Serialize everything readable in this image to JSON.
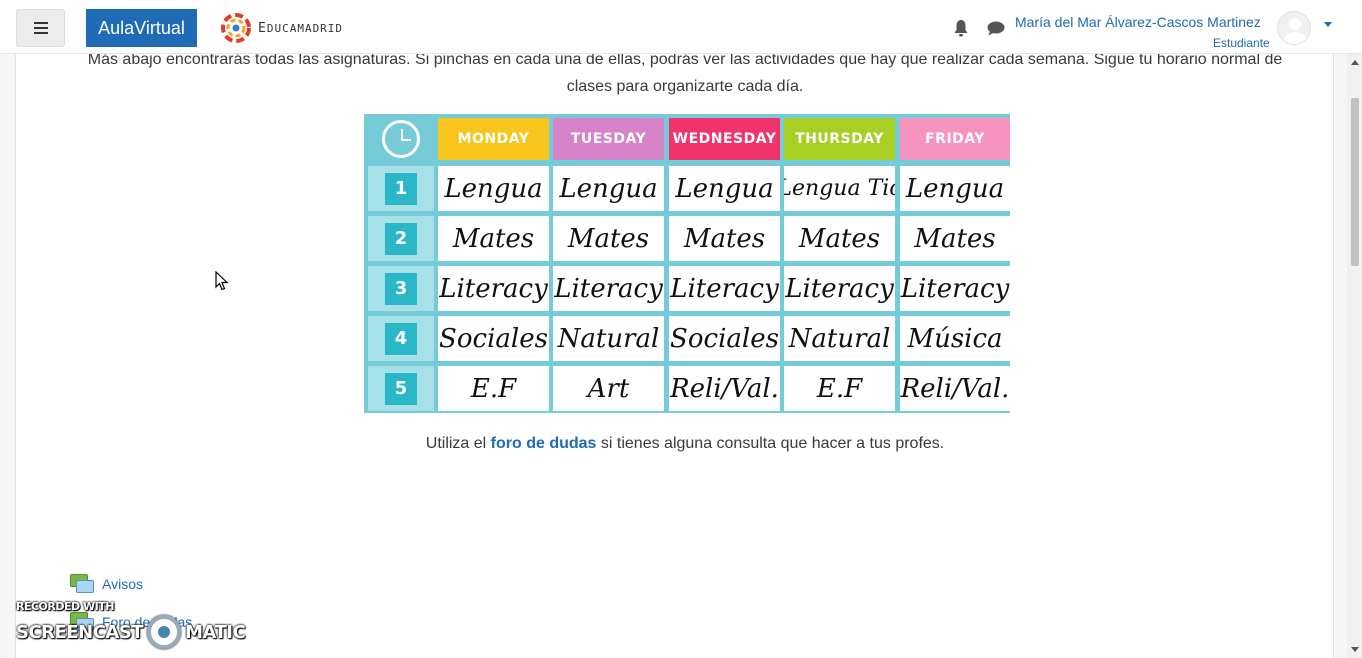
{
  "navbar": {
    "menu_icon": "hamburger-icon",
    "brand": "AulaVirtual",
    "logo_text_big": "E",
    "logo_text_small": "DUCAMADRID",
    "notifications_icon": "bell-icon",
    "messages_icon": "chat-icon",
    "user_name": "María del Mar Álvarez-Cascos Martinez",
    "user_role": "Estudiante",
    "accent": "#1f6bb6"
  },
  "content": {
    "intro": "Más abajo encontrarás todas las asignaturas. Si pinchas en cada una de ellas, podrás ver las actividades que hay que realizar cada semana. Sigue tu horario normal de clases para organizarte cada día.",
    "footer_before": "Utiliza el ",
    "footer_link": "foro de dudas",
    "footer_after": " si tienes alguna consulta que hacer a tus profes."
  },
  "timetable": {
    "days": [
      {
        "label": "MONDAY",
        "color": "#f7c51c"
      },
      {
        "label": "TUESDAY",
        "color": "#d783c9"
      },
      {
        "label": "WEDNESDAY",
        "color": "#f0346b"
      },
      {
        "label": "THURSDAY",
        "color": "#a8cf23"
      },
      {
        "label": "FRIDAY",
        "color": "#f793bf"
      }
    ],
    "periods": [
      "1",
      "2",
      "3",
      "4",
      "5"
    ],
    "rows": [
      [
        "Lengua",
        "Lengua",
        "Lengua",
        "Lengua Tic",
        "Lengua"
      ],
      [
        "Mates",
        "Mates",
        "Mates",
        "Mates",
        "Mates"
      ],
      [
        "Literacy",
        "Literacy",
        "Literacy",
        "Literacy",
        "Literacy"
      ],
      [
        "Sociales",
        "Natural",
        "Sociales",
        "Natural",
        "Música"
      ],
      [
        "E.F",
        "Art",
        "Reli/Val.",
        "E.F",
        "Reli/Val."
      ]
    ]
  },
  "activities": [
    {
      "label": "Avisos",
      "icon": "forum-icon"
    },
    {
      "label": "Foro de dudas",
      "icon": "forum-icon"
    }
  ],
  "watermark": {
    "top": "RECORDED WITH",
    "left": "SCREENCAST",
    "right": "MATIC"
  }
}
